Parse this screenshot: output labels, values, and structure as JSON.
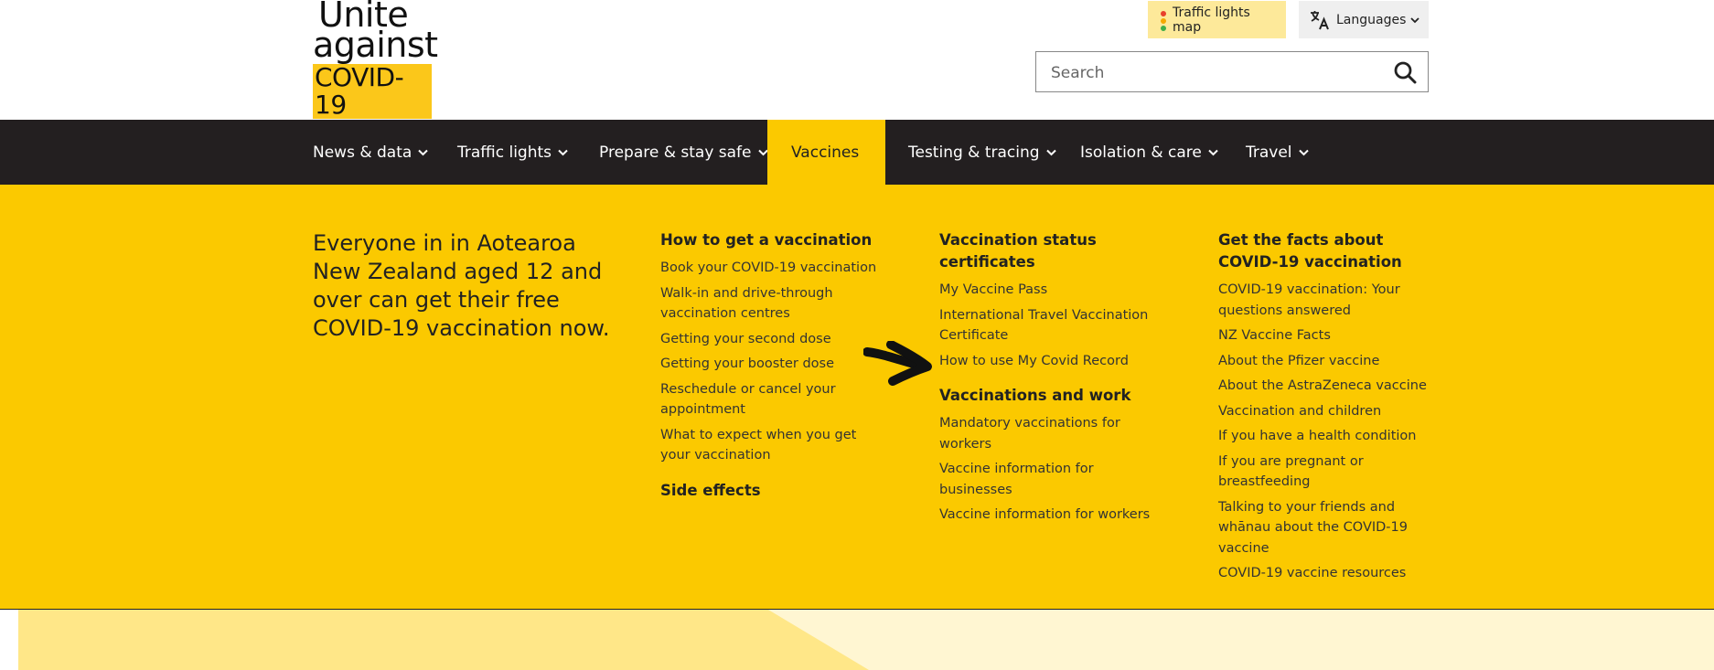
{
  "logo": {
    "line1": "Unite",
    "line2": "against",
    "line3": "COVID-19"
  },
  "header": {
    "traffic_lights_map": "Traffic lights map",
    "languages": "Languages",
    "search_placeholder": "Search"
  },
  "nav": {
    "items": [
      {
        "label": "News & data"
      },
      {
        "label": "Traffic lights"
      },
      {
        "label": "Prepare & stay safe"
      },
      {
        "label": "Vaccines"
      },
      {
        "label": "Testing & tracing"
      },
      {
        "label": "Isolation & care"
      },
      {
        "label": "Travel"
      }
    ],
    "active": "Vaccines"
  },
  "mega": {
    "intro": "Everyone in in Aotearoa New Zealand aged 12 and over can get their free COVID-19 vaccination now.",
    "col1": {
      "heading": "How to get a vaccination",
      "links": [
        "Book your COVID-19 vaccination",
        "Walk-in and drive-through vaccination centres",
        "Getting your second dose",
        "Getting your booster dose",
        "Reschedule or cancel your appointment",
        "What to expect when you get your vaccination"
      ],
      "heading2": "Side effects"
    },
    "col2": {
      "heading": "Vaccination status certificates",
      "links": [
        "My Vaccine Pass",
        "International Travel Vaccination Certificate",
        "How to use My Covid Record"
      ],
      "heading2": "Vaccinations and work",
      "links2": [
        "Mandatory vaccinations for workers",
        "Vaccine information for businesses",
        "Vaccine information for workers"
      ]
    },
    "col3": {
      "heading": "Get the facts about COVID-19 vaccination",
      "links": [
        "COVID-19 vaccination: Your questions answered",
        "NZ Vaccine Facts",
        "About the Pfizer vaccine",
        "About the AstraZeneca vaccine",
        "Vaccination and children",
        "If you have a health condition",
        "If you are pregnant or breastfeeding",
        "Talking to your friends and whānau about the COVID-19 vaccine",
        "COVID-19 vaccine resources"
      ]
    }
  },
  "colors": {
    "yellow": "#fbc900",
    "nav_bg": "#231f20",
    "traffic_btn_bg": "#fde99a"
  }
}
